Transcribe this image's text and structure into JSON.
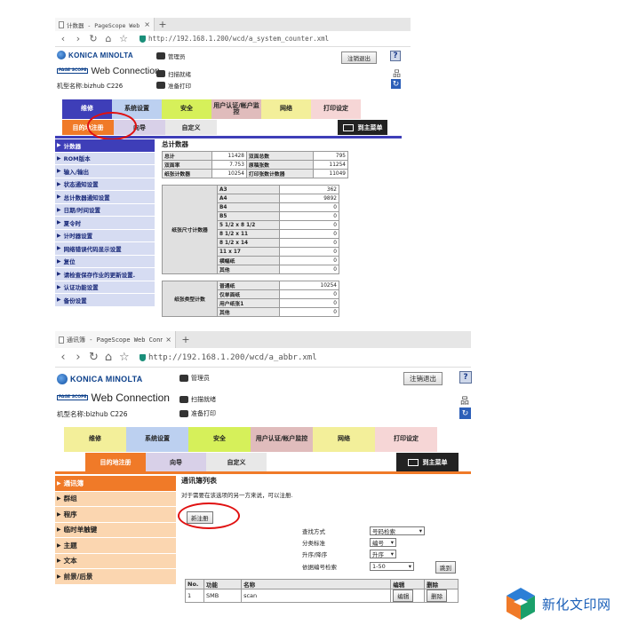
{
  "colors": {
    "accent_orange": "#f07a28",
    "menu_blue": "#3e3eb8",
    "circle_red": "#e01010"
  },
  "shared": {
    "brand": "KONICA MINOLTA",
    "page_scope_badge": "PAGE SCOPE",
    "web_connection": "Web Connection",
    "model": "机型名称:bizhub C226",
    "admin": "管理员",
    "scan_to": "扫描就绪",
    "print_ready": "准备打印",
    "logout": "注销退出",
    "help": "?",
    "menu": [
      "维修",
      "系统设置",
      "安全",
      "用户认证/帐户监控",
      "网络",
      "打印设定"
    ],
    "submenu": [
      "目的地注册",
      "向导",
      "自定义"
    ],
    "to_top_menu": "到主菜单",
    "new_tab": "+",
    "tab_close": "×"
  },
  "panel1": {
    "tab_title": "计数器 - PageScope Web Conn",
    "url": "http://192.168.1.200/wcd/a_system_counter.xml",
    "sidebar": [
      "计数器",
      "ROM版本",
      "输入/输出",
      "状态通知设置",
      "总计数器通知设置",
      "日期/时间设置",
      "夏令时",
      "计时器设置",
      "网络错误代码显示设置",
      "复位",
      "请检查保存作业的更新设置.",
      "认证功能设置",
      "备份设置"
    ],
    "content_title": "总计数器",
    "totals": [
      [
        "总计",
        "11428",
        "双面总数",
        "795"
      ],
      [
        "双面率",
        "7.753",
        "原稿张数",
        "11254"
      ],
      [
        "纸张计数器",
        "10254",
        "打印张数计数器",
        "11049"
      ]
    ],
    "size_group": "纸张尺寸计数器",
    "sizes": [
      [
        "A3",
        "362"
      ],
      [
        "A4",
        "9892"
      ],
      [
        "B4",
        "0"
      ],
      [
        "B5",
        "0"
      ],
      [
        "5 1/2 x 8 1/2",
        "0"
      ],
      [
        "8 1/2 x 11",
        "0"
      ],
      [
        "8 1/2 x 14",
        "0"
      ],
      [
        "11 x 17",
        "0"
      ],
      [
        "横幅纸",
        "0"
      ],
      [
        "其他",
        "0"
      ]
    ],
    "type_group": "纸张类型计数",
    "types": [
      [
        "普通纸",
        "10254"
      ],
      [
        "仅单面纸",
        "0"
      ],
      [
        "用户纸张1",
        "0"
      ],
      [
        "其他",
        "0"
      ]
    ]
  },
  "panel2": {
    "tab_title": "通讯簿 - PageScope Web Conn",
    "url": "http://192.168.1.200/wcd/a_abbr.xml",
    "sidebar": [
      "通讯簿",
      "群组",
      "程序",
      "临时单触键",
      "主题",
      "文本",
      "前景/后景"
    ],
    "content_title": "通讯簿列表",
    "hint": "对于需要在该选项的另一方来说，可以注册.",
    "new_register": "新注册",
    "filters": [
      {
        "label": "查找方式",
        "value": "号码检索"
      },
      {
        "label": "分类标准",
        "value": "编号"
      },
      {
        "label": "升序/降序",
        "value": "升序"
      },
      {
        "label": "依据编号检索",
        "value": "1-50"
      }
    ],
    "go": "跳到",
    "table_headers": [
      "No.",
      "功能",
      "名称",
      "编辑",
      "删除"
    ],
    "rows": [
      {
        "no": "1",
        "func": "SMB",
        "name": "scan",
        "edit": "编辑",
        "del": "删除"
      }
    ]
  },
  "watermark": "新化文印网"
}
